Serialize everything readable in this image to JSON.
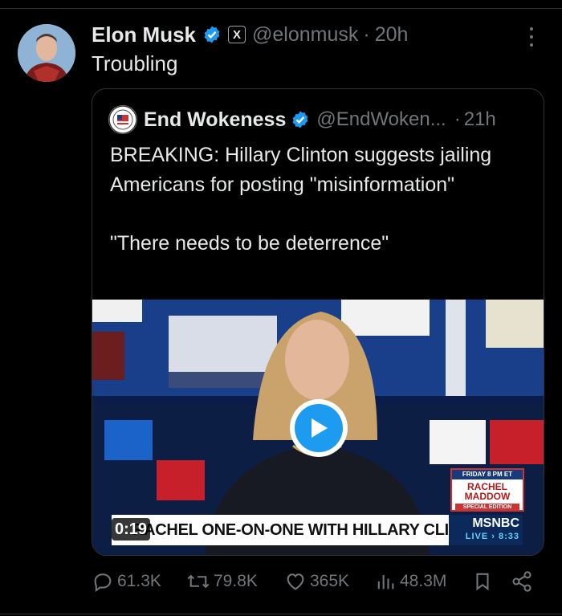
{
  "tweet": {
    "author_name": "Elon Musk",
    "handle": "@elonmusk",
    "separator": "·",
    "time": "20h",
    "text": "Troubling",
    "x_badge": "X"
  },
  "quoted_tweet": {
    "author_name": "End Wokeness",
    "handle": "@EndWoken...",
    "separator": "·",
    "time": "21h",
    "text_lines": [
      "BREAKING: Hillary Clinton suggests jailing Americans for posting \"misinformation\"",
      "\"There needs to be deterrence\""
    ],
    "media": {
      "timer": "0:19",
      "chyron": "RACHEL ONE-ON-ONE WITH HILLARY CLINTON",
      "network": "MSNBC",
      "live_label": "LIVE › 8:33",
      "show_card_top": "FRIDAY 8 PM ET",
      "show_card_name": "RACHEL MADDOW",
      "show_card_sub": "SPECIAL EDITION"
    }
  },
  "actions": {
    "replies": "61.3K",
    "reposts": "79.8K",
    "likes": "365K",
    "views": "48.3M"
  },
  "icons": {
    "verified": "verified-badge-icon",
    "more": "more-options-icon",
    "reply": "reply-icon",
    "repost": "repost-icon",
    "like": "heart-icon",
    "views": "views-icon",
    "bookmark": "bookmark-icon",
    "share": "share-icon",
    "play": "play-icon"
  },
  "colors": {
    "background": "#000000",
    "text_primary": "#e7e9ea",
    "text_secondary": "#71767b",
    "accent": "#1d9bf0",
    "border": "#2f3336"
  }
}
